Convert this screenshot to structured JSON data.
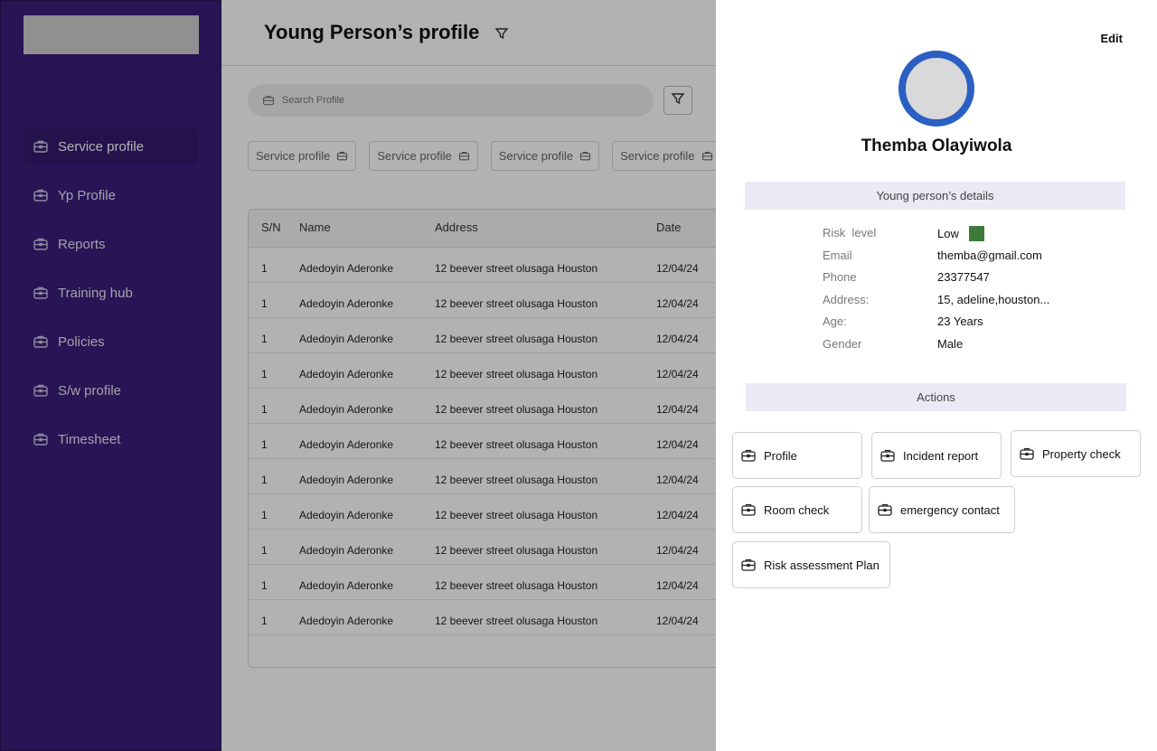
{
  "sidebar": {
    "items": [
      {
        "label": "Service profile",
        "icon": "briefcase-icon",
        "active": true
      },
      {
        "label": "Yp Profile",
        "icon": "briefcase-icon"
      },
      {
        "label": "Reports",
        "icon": "briefcase-icon"
      },
      {
        "label": "Training hub",
        "icon": "briefcase-icon"
      },
      {
        "label": "Policies",
        "icon": "briefcase-icon"
      },
      {
        "label": "S/w profile",
        "icon": "briefcase-icon"
      },
      {
        "label": "Timesheet",
        "icon": "briefcase-icon"
      }
    ]
  },
  "header": {
    "title": "Young Person’s profile"
  },
  "search": {
    "placeholder": "Search Profile"
  },
  "chips": [
    "Service profile",
    "Service profile",
    "Service profile",
    "Service profile"
  ],
  "table": {
    "columns": [
      "S/N",
      "Name",
      "Address",
      "Date"
    ],
    "rows": [
      [
        "1",
        "Adedoyin Aderonke",
        "12 beever street olusaga Houston",
        "12/04/24"
      ],
      [
        "1",
        "Adedoyin Aderonke",
        "12 beever street olusaga Houston",
        "12/04/24"
      ],
      [
        "1",
        "Adedoyin Aderonke",
        "12 beever street olusaga Houston",
        "12/04/24"
      ],
      [
        "1",
        "Adedoyin Aderonke",
        "12 beever street olusaga Houston",
        "12/04/24"
      ],
      [
        "1",
        "Adedoyin Aderonke",
        "12 beever street olusaga Houston",
        "12/04/24"
      ],
      [
        "1",
        "Adedoyin Aderonke",
        "12 beever street olusaga Houston",
        "12/04/24"
      ],
      [
        "1",
        "Adedoyin Aderonke",
        "12 beever street olusaga Houston",
        "12/04/24"
      ],
      [
        "1",
        "Adedoyin Aderonke",
        "12 beever street olusaga Houston",
        "12/04/24"
      ],
      [
        "1",
        "Adedoyin Aderonke",
        "12 beever street olusaga Houston",
        "12/04/24"
      ],
      [
        "1",
        "Adedoyin Aderonke",
        "12 beever street olusaga Houston",
        "12/04/24"
      ],
      [
        "1",
        "Adedoyin Aderonke",
        "12 beever street olusaga Houston",
        "12/04/24"
      ]
    ]
  },
  "panel": {
    "edit_label": "Edit",
    "name": "Themba Olayiwola",
    "details_title": "Young person’s details",
    "details": [
      {
        "label": "Risk  level",
        "value": "Low"
      },
      {
        "label": "Email",
        "value": "themba@gmail.com"
      },
      {
        "label": "Phone",
        "value": "23377547"
      },
      {
        "label": "Address:",
        "value": "15, adeline,houston..."
      },
      {
        "label": "Age:",
        "value": "23 Years"
      },
      {
        "label": "Gender",
        "value": "Male"
      }
    ],
    "risk_color": "#3f7a3a",
    "actions_title": "Actions",
    "actions": [
      "Profile",
      "Incident report",
      "Property check",
      "Room check",
      "emergency contact",
      "Risk assessment Plan"
    ]
  },
  "colors": {
    "sidebar": "#3b1d7a",
    "avatar_ring": "#2b5fc2",
    "section_bar": "#ece8f5"
  }
}
